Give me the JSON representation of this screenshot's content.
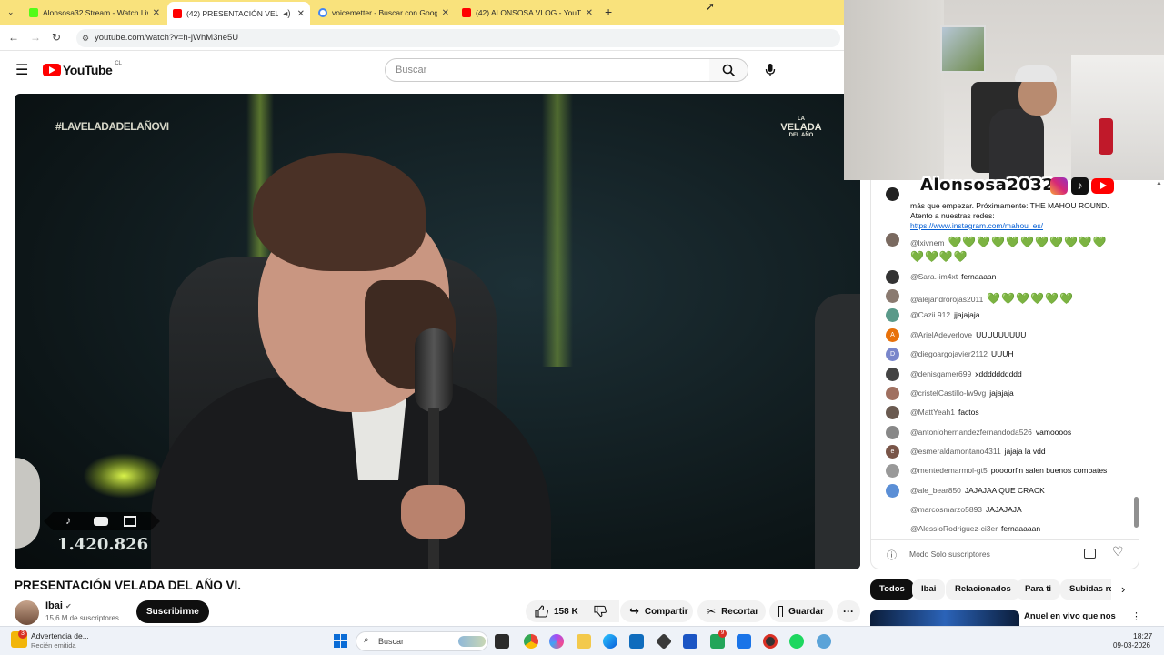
{
  "browser": {
    "tabs": [
      {
        "title": "Alonsosa32 Stream - Watch Liv",
        "color": "#53fc18"
      },
      {
        "title": "(42) PRESENTACIÓN VELADA",
        "color": "#ff0000"
      },
      {
        "title": "voicemetter - Buscar con Goog",
        "color": "#4285f4"
      },
      {
        "title": "(42) ALONSOSA VLOG - YouTub",
        "color": "#ff0000"
      }
    ],
    "url": "youtube.com/watch?v=h-jWhM3ne5U"
  },
  "youtube": {
    "logo": "YouTube",
    "region": "CL",
    "search_placeholder": "Buscar"
  },
  "video": {
    "overlay_hashtag": "#LAVELADADELAÑOVI",
    "corner_logo_top": "LA",
    "corner_logo_main": "VELADA",
    "corner_logo_bottom": "DEL AÑO",
    "viewer_count": "1.420.826",
    "title": "PRESENTACIÓN VELADA DEL AÑO VI."
  },
  "channel": {
    "name": "Ibai",
    "subscribers": "15,6 M de suscriptores",
    "subscribe_label": "Suscribirme"
  },
  "actions": {
    "likes": "158 K",
    "share": "Compartir",
    "clip": "Recortar",
    "save": "Guardar"
  },
  "streamer": {
    "handle": "Alonsosa2032"
  },
  "chat": {
    "pinned_text": "más que empezar. Próximamente: THE MAHOU ROUND. Atento a nuestras redes:",
    "pinned_link": "https://www.instagram.com/mahou_es/",
    "messages": [
      {
        "author": "@lxivnem",
        "text": "💚💚💚💚💚💚💚💚💚💚💚💚💚💚💚",
        "color": "#7a6a60"
      },
      {
        "author": "@Sara.-im4xt",
        "text": "fernaaaan",
        "color": "#333333"
      },
      {
        "author": "@alejandrorojas2011",
        "text": "💚💚💚💚💚💚",
        "color": "#8a7a70"
      },
      {
        "author": "@Cazii.912",
        "text": "jjajajaja",
        "color": "#5a9a8a"
      },
      {
        "author": "@ArielAdeverlove",
        "text": "UUUUUUUUU",
        "color": "#e8710a",
        "initial": "A"
      },
      {
        "author": "@diegoargojavier2112",
        "text": "UUUH",
        "color": "#7986cb",
        "initial": "D"
      },
      {
        "author": "@denisgamer699",
        "text": "xdddddddddd",
        "color": "#444444"
      },
      {
        "author": "@cristelCastillo-lw9vg",
        "text": "jajajaja",
        "color": "#a07060"
      },
      {
        "author": "@MattYeah1",
        "text": "factos",
        "color": "#6a5a50"
      },
      {
        "author": "@antoniohernandezfernandoda526",
        "text": "vamoooos",
        "color": "#888888"
      },
      {
        "author": "@esmeraldamontano4311",
        "text": "jajaja la vdd",
        "color": "#795548",
        "initial": "e"
      },
      {
        "author": "@mentedemarmol-gt5",
        "text": "poooorfin salen buenos combates",
        "color": "#999999"
      },
      {
        "author": "@ale_bear850",
        "text": "JAJAJAA QUE CRACK",
        "color": "#5b8fd6"
      },
      {
        "author": "@marcosmarzo5893",
        "text": "JAJAJAJA",
        "color": ""
      },
      {
        "author": "@AlessioRodriguez-ci3er",
        "text": "fernaaaaan",
        "color": ""
      }
    ],
    "footer": "Modo Solo suscriptores"
  },
  "chips": [
    "Todos",
    "Ibai",
    "Relacionados",
    "Para ti",
    "Subidas re"
  ],
  "recommended": {
    "title": "Anuel en vivo que nos"
  },
  "taskbar": {
    "notification_title": "Advertencia de...",
    "notification_sub": "Recién emitida",
    "notification_badge": "3",
    "search_label": "Buscar",
    "time": "18:27",
    "date": "09-03-2026",
    "badge": "9"
  }
}
